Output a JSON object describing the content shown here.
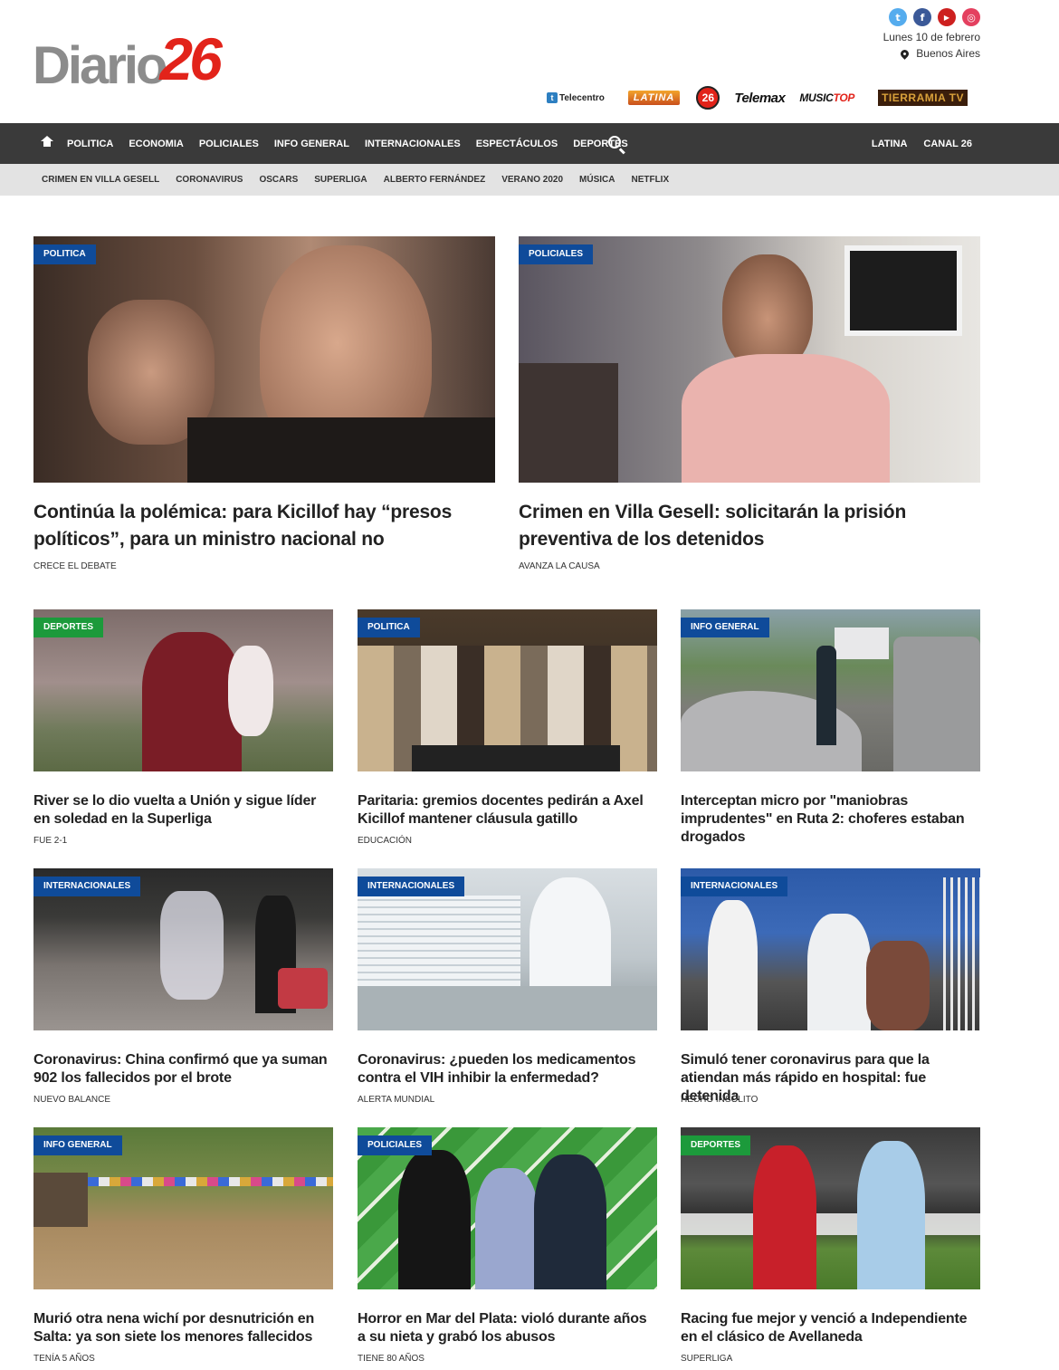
{
  "brand": {
    "logo_word": "Diario",
    "logo_number": "26",
    "accent_red": "#e2231a",
    "nav_dark": "#3a3a3a",
    "badge_blue": "#0f4b9a",
    "badge_green": "#1c9a3b"
  },
  "header": {
    "social": [
      {
        "icon": "twitter-icon",
        "glyph": "t",
        "color": "#55acee"
      },
      {
        "icon": "facebook-icon",
        "glyph": "f",
        "color": "#3b5998"
      },
      {
        "icon": "youtube-icon",
        "glyph": "▶",
        "color": "#cd201f"
      },
      {
        "icon": "instagram-icon",
        "glyph": "◎",
        "color": "#e4405f"
      }
    ],
    "date": "Lunes 10 de febrero",
    "location": "Buenos Aires",
    "channels": {
      "telecentro": "Telecentro",
      "latina": "LATINA",
      "c26": "26",
      "telemax": "Telemax",
      "music_a": "MUSIC",
      "music_b": "TOP",
      "tierramia": "TIERRAMIA TV"
    }
  },
  "main_nav": {
    "items": [
      "POLITICA",
      "ECONOMIA",
      "POLICIALES",
      "INFO GENERAL",
      "INTERNACIONALES",
      "ESPECTÁCULOS",
      "DEPORTES"
    ],
    "right": [
      "LATINA",
      "CANAL 26"
    ]
  },
  "sub_nav": {
    "items": [
      "CRIMEN EN VILLA GESELL",
      "CORONAVIRUS",
      "OSCARS",
      "SUPERLIGA",
      "ALBERTO FERNÁNDEZ",
      "VERANO 2020",
      "MÚSICA",
      "NETFLIX"
    ]
  },
  "articles": [
    {
      "category": "POLITICA",
      "color": "blue",
      "title": "Continúa la polémica: para Kicillof hay “presos políticos”, para un ministro nacional no",
      "kicker": "CRECE EL DEBATE"
    },
    {
      "category": "POLICIALES",
      "color": "blue",
      "title": "Crimen en Villa Gesell: solicitarán la prisión preventiva de los detenidos",
      "kicker": "AVANZA LA CAUSA"
    },
    {
      "category": "DEPORTES",
      "color": "green",
      "title": "River se lo dio vuelta a Unión y sigue líder en soledad en la Superliga",
      "kicker": "FUE 2-1"
    },
    {
      "category": "POLITICA",
      "color": "blue",
      "title": "Paritaria: gremios docentes pedirán a Axel Kicillof mantener cláusula gatillo",
      "kicker": "EDUCACIÓN"
    },
    {
      "category": "INFO GENERAL",
      "color": "blue",
      "title": "Interceptan micro por \"maniobras imprudentes\" en Ruta 2: choferes estaban drogados",
      "kicker": ""
    },
    {
      "category": "INTERNACIONALES",
      "color": "blue",
      "title": "Coronavirus: China confirmó que ya suman 902 los fallecidos por el brote",
      "kicker": "NUEVO BALANCE"
    },
    {
      "category": "INTERNACIONALES",
      "color": "blue",
      "title": "Coronavirus: ¿pueden los medicamentos contra el VIH inhibir la enfermedad?",
      "kicker": "ALERTA MUNDIAL"
    },
    {
      "category": "INTERNACIONALES",
      "color": "blue",
      "title": "Simuló tener coronavirus para que la atiendan más rápido en hospital: fue detenida",
      "kicker": "HECHO INSÓLITO"
    },
    {
      "category": "INFO GENERAL",
      "color": "blue",
      "title": "Murió otra nena wichí por desnutrición en Salta: ya son siete los menores fallecidos",
      "kicker": "TENÍA 5 AÑOS"
    },
    {
      "category": "POLICIALES",
      "color": "blue",
      "title": "Horror en Mar del Plata: violó durante años a su nieta y grabó los abusos",
      "kicker": "TIENE 80 AÑOS"
    },
    {
      "category": "DEPORTES",
      "color": "green",
      "title": "Racing fue mejor y venció a Independiente en el clásico de Avellaneda",
      "kicker": "SUPERLIGA"
    }
  ]
}
